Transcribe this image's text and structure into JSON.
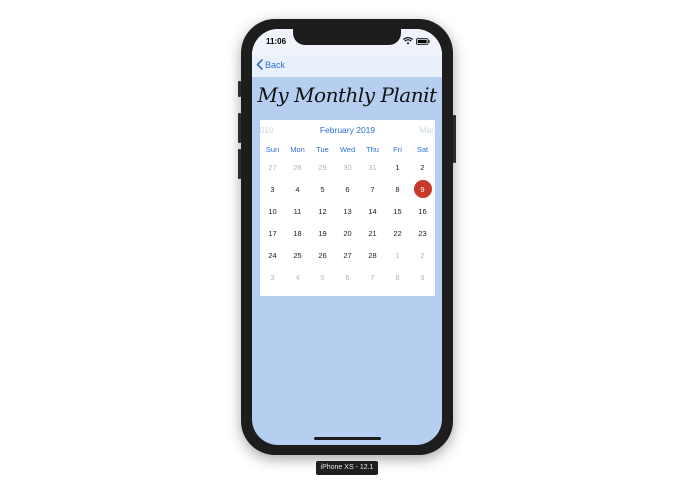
{
  "status_bar": {
    "time": "11:06"
  },
  "nav": {
    "back_label": "Back"
  },
  "page": {
    "title": "My Monthly Planit"
  },
  "calendar": {
    "prev_month": "y 2019",
    "current_month": "February 2019",
    "next_month": "March",
    "weekdays": [
      "Sun",
      "Mon",
      "Tue",
      "Wed",
      "Thu",
      "Fri",
      "Sat"
    ],
    "weeks": [
      [
        {
          "d": "27",
          "m": true
        },
        {
          "d": "28",
          "m": true
        },
        {
          "d": "29",
          "m": true
        },
        {
          "d": "30",
          "m": true
        },
        {
          "d": "31",
          "m": true
        },
        {
          "d": "1"
        },
        {
          "d": "2"
        }
      ],
      [
        {
          "d": "3"
        },
        {
          "d": "4"
        },
        {
          "d": "5"
        },
        {
          "d": "6"
        },
        {
          "d": "7"
        },
        {
          "d": "8"
        },
        {
          "d": "9",
          "s": true
        }
      ],
      [
        {
          "d": "10"
        },
        {
          "d": "11"
        },
        {
          "d": "12"
        },
        {
          "d": "13"
        },
        {
          "d": "14"
        },
        {
          "d": "15"
        },
        {
          "d": "16"
        }
      ],
      [
        {
          "d": "17"
        },
        {
          "d": "18"
        },
        {
          "d": "19"
        },
        {
          "d": "20"
        },
        {
          "d": "21"
        },
        {
          "d": "22"
        },
        {
          "d": "23"
        }
      ],
      [
        {
          "d": "24"
        },
        {
          "d": "25"
        },
        {
          "d": "26"
        },
        {
          "d": "27"
        },
        {
          "d": "28"
        },
        {
          "d": "1",
          "m": true
        },
        {
          "d": "2",
          "m": true
        }
      ],
      [
        {
          "d": "3",
          "m": true
        },
        {
          "d": "4",
          "m": true
        },
        {
          "d": "5",
          "m": true
        },
        {
          "d": "6",
          "m": true
        },
        {
          "d": "7",
          "m": true
        },
        {
          "d": "8",
          "m": true
        },
        {
          "d": "9",
          "m": true
        }
      ]
    ],
    "selected_color": "#c8392b",
    "accent_color": "#2f6fd6"
  },
  "device": {
    "label": "iPhone XS - 12.1"
  },
  "icons": [
    "wifi-icon",
    "battery-icon",
    "chevron-left-icon"
  ]
}
